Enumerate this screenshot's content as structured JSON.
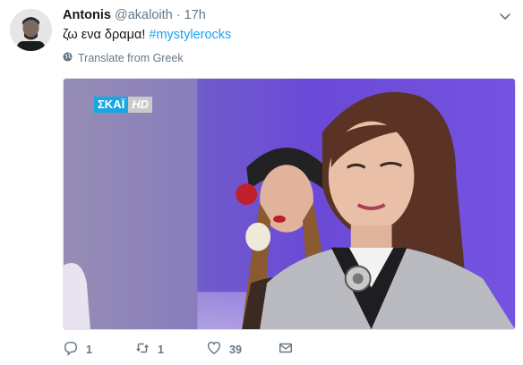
{
  "tweet": {
    "name": "Antonis",
    "handle": "@akaloith",
    "dot": "·",
    "time": "17h",
    "text": "ζω ενα δραμα! ",
    "hashtag": "#mystylerocks",
    "translate_label": "Translate from Greek"
  },
  "media": {
    "channel_logo": "ΣΚΑΪ",
    "hd_badge": "HD"
  },
  "actions": {
    "reply_count": "1",
    "retweet_count": "1",
    "like_count": "39"
  },
  "colors": {
    "link": "#1da1f2",
    "secondary": "#657786",
    "stage_purple": "#6b4bd8"
  }
}
